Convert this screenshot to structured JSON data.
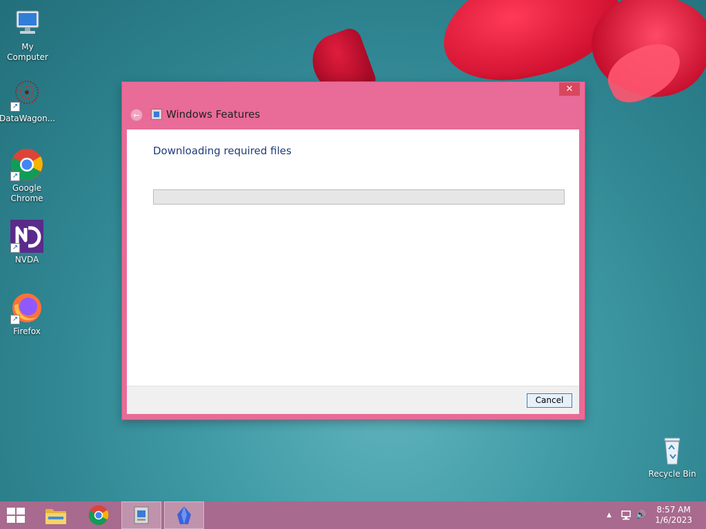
{
  "desktop": {
    "icons": [
      {
        "label": "My Computer"
      },
      {
        "label": "DataWagon..."
      },
      {
        "label": "Google Chrome"
      },
      {
        "label": "NVDA"
      },
      {
        "label": "Firefox"
      },
      {
        "label": "Recycle Bin"
      }
    ]
  },
  "dialog": {
    "title": "Windows Features",
    "close_glyph": "✕",
    "back_glyph": "←",
    "heading": "Downloading required files",
    "progress_fraction": 0,
    "cancel_label": "Cancel"
  },
  "taskbar": {
    "apps": [
      {
        "icon": "start-icon"
      },
      {
        "icon": "file-explorer-icon"
      },
      {
        "icon": "chrome-icon"
      },
      {
        "icon": "windows-features-icon",
        "active": true
      },
      {
        "icon": "blue-crystal-app-icon",
        "active": true
      }
    ],
    "clock": {
      "time": "8:57 AM",
      "date": "1/6/2023"
    },
    "tray_glyphs": {
      "chevron": "▲",
      "speaker": "🔊"
    }
  },
  "colors": {
    "titlebar": "#e96b97",
    "close_button": "#d9475d",
    "taskbar": "#a86a8e",
    "heading_text": "#1e3d7a"
  }
}
